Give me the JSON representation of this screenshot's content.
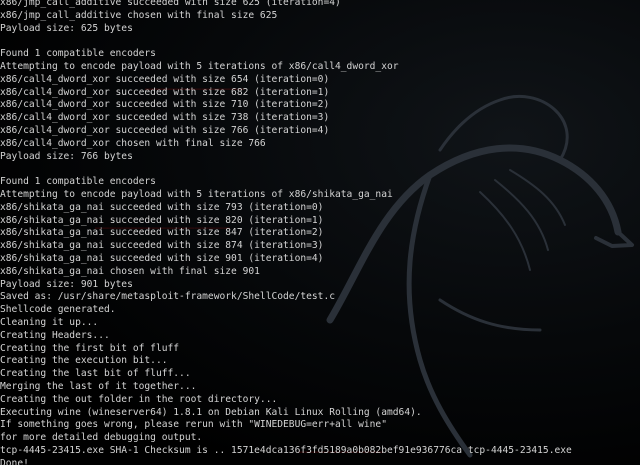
{
  "terminal": {
    "lines": [
      "x86/jmp_call_additive succeeded with size 625 (iteration=4)",
      "x86/jmp_call_additive chosen with final size 625",
      "Payload size: 625 bytes",
      "",
      "Found 1 compatible encoders",
      "Attempting to encode payload with 5 iterations of x86/call4_dword_xor",
      "x86/call4_dword_xor succeeded with size 654 (iteration=0)",
      "x86/call4_dword_xor succeeded with size 682 (iteration=1)",
      "x86/call4_dword_xor succeeded with size 710 (iteration=2)",
      "x86/call4_dword_xor succeeded with size 738 (iteration=3)",
      "x86/call4_dword_xor succeeded with size 766 (iteration=4)",
      "x86/call4_dword_xor chosen with final size 766",
      "Payload size: 766 bytes",
      "",
      "Found 1 compatible encoders",
      "Attempting to encode payload with 5 iterations of x86/shikata_ga_nai",
      "x86/shikata_ga_nai succeeded with size 793 (iteration=0)",
      "x86/shikata_ga_nai succeeded with size 820 (iteration=1)",
      "x86/shikata_ga_nai succeeded with size 847 (iteration=2)",
      "x86/shikata_ga_nai succeeded with size 874 (iteration=3)",
      "x86/shikata_ga_nai succeeded with size 901 (iteration=4)",
      "x86/shikata_ga_nai chosen with final size 901",
      "Payload size: 901 bytes",
      "Saved as: /usr/share/metasploit-framework/ShellCode/test.c",
      "Shellcode generated.",
      "Cleaning it up...",
      "Creating Headers...",
      "Creating the first bit of fluff",
      "Creating the execution bit...",
      "Creating the last bit of fluff...",
      "Merging the last of it together...",
      "Creating the out folder in the root directory...",
      "Executing wine (wineserver64) 1.8.1 on Debian Kali Linux Rolling (amd64).",
      "If something goes wrong, please rerun with \"WINEDEBUG=err+all wine\"",
      "for more detailed debugging output.",
      "tcp-4445-23415.exe SHA-1 Checksum is .. 1571e4dca136f3fd5189a0b082bef91e936776ca tcp-4445-23415.exe",
      "Done!"
    ]
  },
  "colors": {
    "background": "#000000",
    "text": "#d4d4d4",
    "watermark": "#c81414"
  }
}
